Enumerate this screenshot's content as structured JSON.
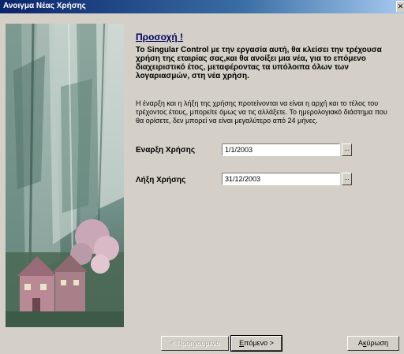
{
  "window": {
    "title": "Ανοιγμα Νέας Χρήσης",
    "close_glyph": "✕"
  },
  "notice": {
    "heading": "Προσοχή !",
    "warning": "Το Singular Control με την εργασία αυτή, θα κλείσει την τρέχουσα χρήση της εταιρίας σας,και θα ανοίξει μια νέα, για το επόμενο διαχειριστικό έτος, μεταφέροντας τα υπόλοιπα όλων των λογαριασμών, στη νέα χρήση.",
    "info": "Η έναρξη και η λήξη της χρήσης προτείνονται να είναι η αρχή και το τέλος του τρέχοντος έτους, μπορείτε όμως να τις αλλάξετε. Το ημερολογιακό διάστημα που θα ορίσετε, δεν μπορεί να είναι μεγαλύτερο από 24 μήνες."
  },
  "fields": {
    "start": {
      "label": "Εναρξη Χρήσης",
      "value": "1/1/2003",
      "button": "..."
    },
    "end": {
      "label": "Λήξη Χρήσης",
      "value": "31/12/2003",
      "button": "..."
    }
  },
  "buttons": {
    "back": "< Προηγούμενο",
    "next_mnemonic": "Ε",
    "next_rest": "πόμενο >",
    "cancel_mnemonic": "κ",
    "cancel_pre": "Α",
    "cancel_post": "ύρωση"
  },
  "colors": {
    "titlebar_start": "#0a246a",
    "titlebar_end": "#a6caf0",
    "dialog_face": "#d4d0c8",
    "heading_color": "#000060"
  },
  "icons": {
    "close": "close-icon"
  }
}
